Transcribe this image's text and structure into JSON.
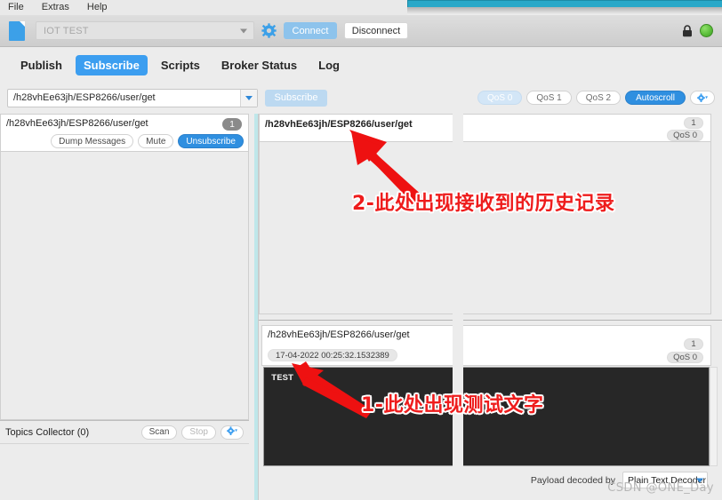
{
  "menubar": {
    "items": [
      {
        "label": "File"
      },
      {
        "label": "Extras"
      },
      {
        "label": "Help"
      }
    ]
  },
  "connection_bar": {
    "profile_value": "IOT TEST",
    "connect_label": "Connect",
    "disconnect_label": "Disconnect",
    "gear_icon": "gear-icon",
    "lock_icon": "lock-icon",
    "status_indicator": "connected-green-led",
    "status_color": "#5cbf3b"
  },
  "tabs": {
    "items": [
      {
        "label": "Publish",
        "active": false
      },
      {
        "label": "Subscribe",
        "active": true
      },
      {
        "label": "Scripts",
        "active": false
      },
      {
        "label": "Broker Status",
        "active": false
      },
      {
        "label": "Log",
        "active": false
      }
    ],
    "active_color": "#3c9ef0"
  },
  "subscribe_row": {
    "topic_value": "/h28vhEe63jh/ESP8266/user/get",
    "subscribe_label": "Subscribe",
    "qos": [
      {
        "label": "QoS 0",
        "selected": true
      },
      {
        "label": "QoS 1",
        "selected": false
      },
      {
        "label": "QoS 2",
        "selected": false
      }
    ],
    "autoscroll_label": "Autoscroll",
    "autoscroll_active": true,
    "options_icon": "cog-dropdown-icon"
  },
  "left_panel": {
    "subscription": {
      "topic": "/h28vhEe63jh/ESP8266/user/get",
      "count": "1",
      "dump_label": "Dump Messages",
      "mute_label": "Mute",
      "unsubscribe_label": "Unsubscribe"
    },
    "topics_collector": {
      "title": "Topics Collector (0)",
      "scan_label": "Scan",
      "stop_label": "Stop",
      "options_icon": "cog-dropdown-icon"
    }
  },
  "history_panel": {
    "topic": "/h28vhEe63jh/ESP8266/user/get",
    "count": "1",
    "qos": "QoS 0"
  },
  "message_panel": {
    "topic": "/h28vhEe63jh/ESP8266/user/get",
    "timestamp": "17-04-2022 00:25:32.1532389",
    "count": "1",
    "qos": "QoS 0",
    "payload": "TEST",
    "decoder_label": "Payload decoded by",
    "decoder_value": "Plain Text Decoder"
  },
  "annotations": {
    "note_1": "1-此处出现测试文字",
    "note_2": "2-此处出现接收到的历史记录",
    "color": "#ee1c1c"
  },
  "watermark": "CSDN @ONE_Day"
}
